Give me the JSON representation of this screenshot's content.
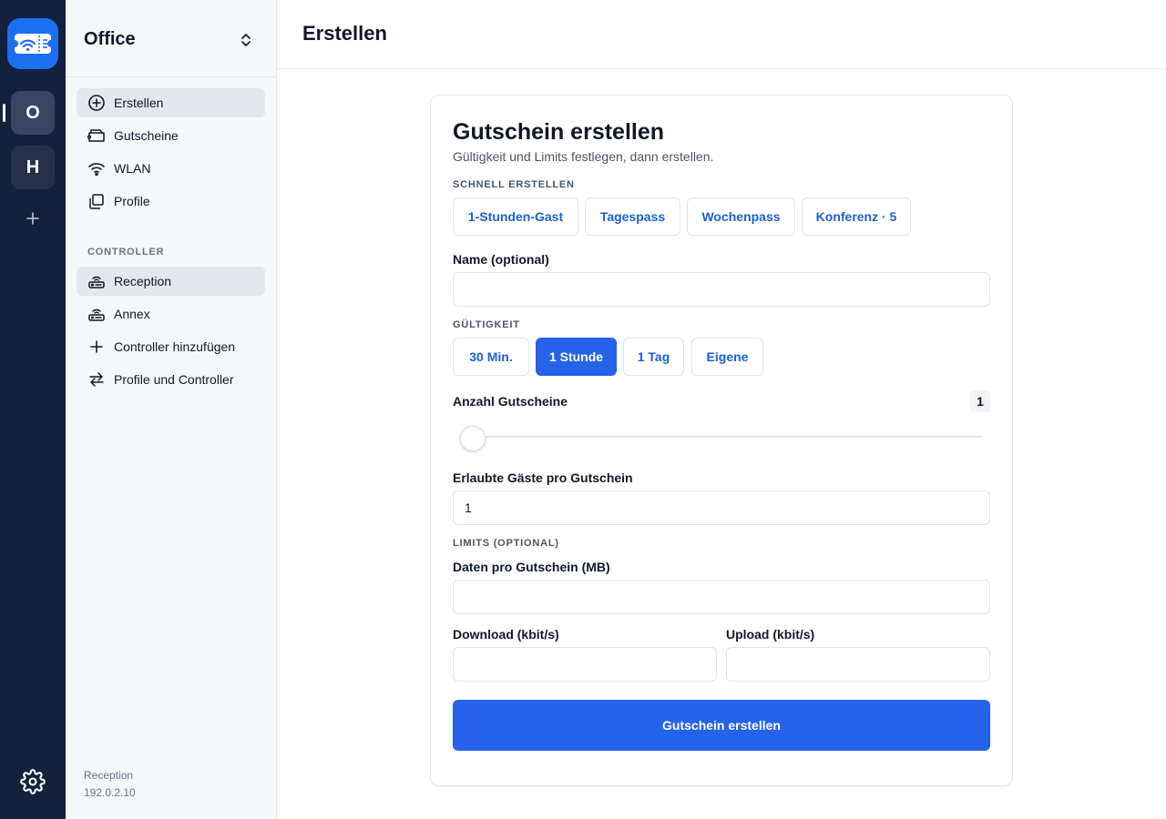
{
  "rail": {
    "accounts": [
      {
        "letter": "O",
        "active": true
      },
      {
        "letter": "H",
        "active": false
      }
    ],
    "add_icon": "plus-icon",
    "settings_icon": "gear-icon",
    "logo_icon": "wifi-ticket-icon"
  },
  "sidebar": {
    "profile_name": "Office",
    "main_nav": [
      {
        "label": "Erstellen",
        "icon": "plus-circle-icon",
        "active": true
      },
      {
        "label": "Gutscheine",
        "icon": "ticket-icon",
        "active": false
      },
      {
        "label": "WLAN",
        "icon": "wifi-icon",
        "active": false
      },
      {
        "label": "Profile",
        "icon": "copy-icon",
        "active": false
      }
    ],
    "controller_section_label": "CONTROLLER",
    "controller_nav": [
      {
        "label": "Reception",
        "icon": "router-icon",
        "active": true
      },
      {
        "label": "Annex",
        "icon": "router-icon",
        "active": false
      },
      {
        "label": "Controller hinzufügen",
        "icon": "plus-icon",
        "active": false
      },
      {
        "label": "Profile und Controller",
        "icon": "arrows-swap-icon",
        "active": false
      }
    ],
    "footer": {
      "name": "Reception",
      "ip": "192.0.2.10"
    }
  },
  "header": {
    "title": "Erstellen"
  },
  "form": {
    "title": "Gutschein erstellen",
    "subtitle": "Gültigkeit und Limits festlegen, dann erstellen.",
    "quick_label": "SCHNELL ERSTELLEN",
    "quick_presets": [
      "1-Stunden-Gast",
      "Tagespass",
      "Wochenpass",
      "Konferenz · 5"
    ],
    "name_label": "Name (optional)",
    "name_value": "",
    "validity_label": "GÜLTIGKEIT",
    "validity_options": [
      "30 Min.",
      "1 Stunde",
      "1 Tag",
      "Eigene"
    ],
    "validity_selected": "1 Stunde",
    "count_label": "Anzahl Gutscheine",
    "count_value": "1",
    "guests_label": "Erlaubte Gäste pro Gutschein",
    "guests_value": "1",
    "limits_label": "LIMITS (OPTIONAL)",
    "data_label": "Daten pro Gutschein (MB)",
    "data_value": "",
    "download_label": "Download (kbit/s)",
    "download_value": "",
    "upload_label": "Upload (kbit/s)",
    "upload_value": "",
    "submit_label": "Gutschein erstellen"
  },
  "colors": {
    "accent": "#2563eb",
    "rail_bg": "#14213d",
    "logo_bg": "#1d6ff2"
  }
}
